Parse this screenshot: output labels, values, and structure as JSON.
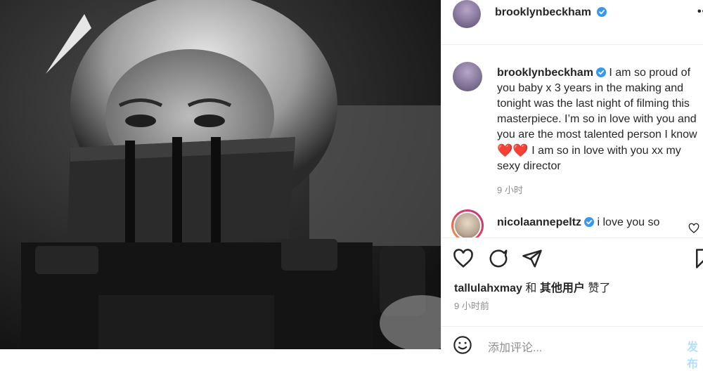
{
  "post": {
    "author": "brooklynbeckham",
    "more_label": "••"
  },
  "caption": {
    "author": "brooklynbeckham",
    "text_part1": "I am so proud of you baby x 3 years in the making and tonight was the last night of filming this masterpiece. I’m so in love with you and you are the most talented person I know",
    "emoji": "❤️❤️",
    "text_part2": "I am so in love with you xx my sexy director",
    "time": "9 小时"
  },
  "comment": {
    "author": "nicolaannepeltz",
    "text": "i love you so"
  },
  "likes": {
    "first_user": "tallulahxmay",
    "and": "和",
    "others": "其他用户",
    "liked": "赞了"
  },
  "posted_time": "9 小时前",
  "add_comment": {
    "placeholder": "添加评论...",
    "post_label": "发布"
  },
  "colors": {
    "verified": "#3897f0",
    "heart": "#e0143c",
    "post_button_disabled": "#b2dffc",
    "secondary_text": "#8e8e8e"
  }
}
